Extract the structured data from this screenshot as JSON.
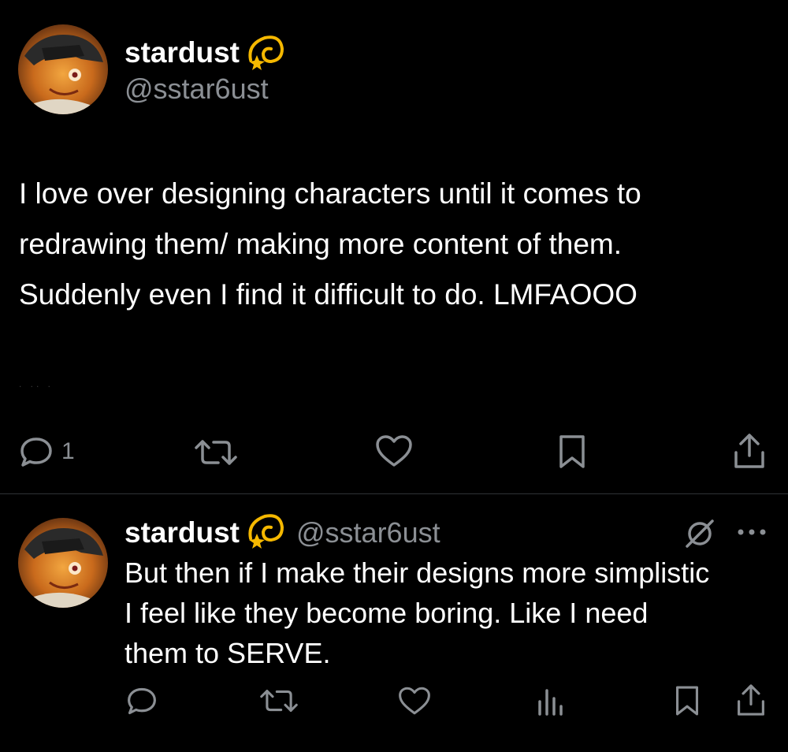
{
  "tweet": {
    "display_name": "stardust",
    "handle": "@sstar6ust",
    "name_emoji": "dizzy-emoji",
    "text": "I love over designing characters until it comes to\nredrawing them/ making more content of them.\nSuddenly even I find it difficult to do. LMFAOOO",
    "actions": {
      "reply_count": "1",
      "icons": [
        "reply-icon",
        "retweet-icon",
        "like-icon",
        "bookmark-icon",
        "share-icon"
      ]
    }
  },
  "reply": {
    "display_name": "stardust",
    "handle": "@sstar6ust",
    "name_emoji": "dizzy-emoji",
    "text": "But then if I make their designs more simplistic\nI feel like they become boring. Like I need\nthem to SERVE.",
    "header_icons": [
      "grok-icon",
      "more-icon"
    ],
    "actions": {
      "icons": [
        "reply-icon",
        "retweet-icon",
        "like-icon",
        "views-icon",
        "bookmark-icon",
        "share-icon"
      ]
    }
  },
  "colors": {
    "background": "#000000",
    "text": "#ffffff",
    "secondary": "#8b8f94",
    "divider": "#2f3336"
  }
}
